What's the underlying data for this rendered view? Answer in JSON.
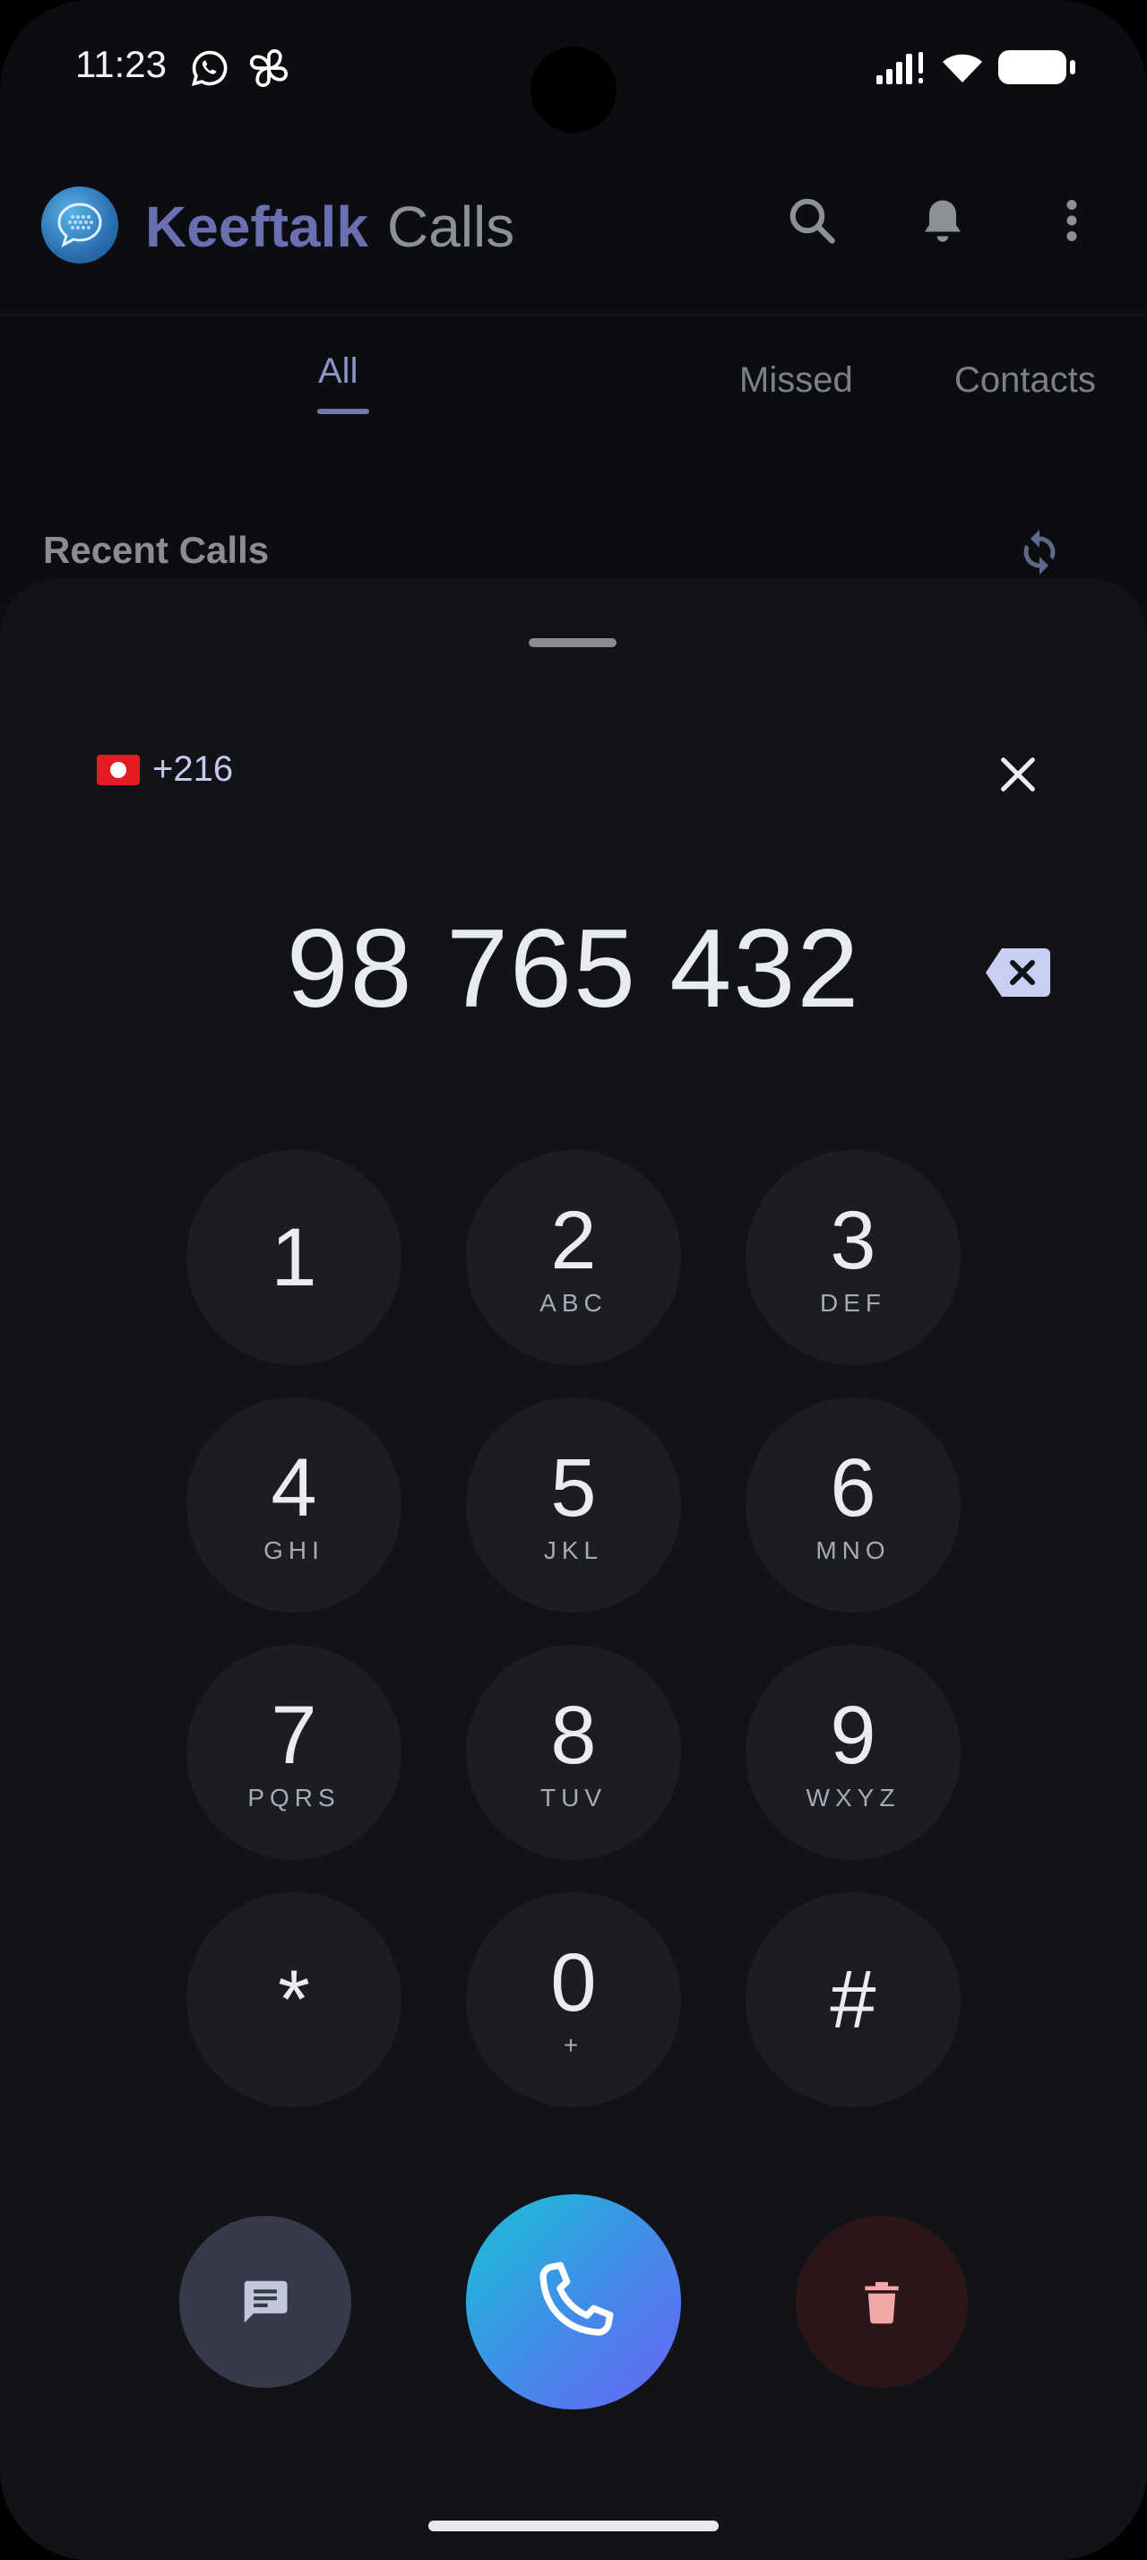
{
  "status_bar": {
    "time": "11:23"
  },
  "app_bar": {
    "brand": "Keeftalk",
    "title": "Calls"
  },
  "tabs": [
    {
      "label": "All",
      "active": true
    },
    {
      "label": "Missed"
    },
    {
      "label": "Contacts"
    }
  ],
  "recent": {
    "label": "Recent Calls"
  },
  "dialer": {
    "country_code": "+216",
    "number": "98 765 432",
    "keys": [
      {
        "digit": "1",
        "letters": ""
      },
      {
        "digit": "2",
        "letters": "ABC"
      },
      {
        "digit": "3",
        "letters": "DEF"
      },
      {
        "digit": "4",
        "letters": "GHI"
      },
      {
        "digit": "5",
        "letters": "JKL"
      },
      {
        "digit": "6",
        "letters": "MNO"
      },
      {
        "digit": "7",
        "letters": "PQRS"
      },
      {
        "digit": "8",
        "letters": "TUV"
      },
      {
        "digit": "9",
        "letters": "WXYZ"
      },
      {
        "digit": "*",
        "letters": ""
      },
      {
        "digit": "0",
        "letters": "+"
      },
      {
        "digit": "#",
        "letters": ""
      }
    ]
  },
  "colors": {
    "accent": "#6a6fb0",
    "call_gradient_start": "#19c3d6",
    "call_gradient_end": "#6b63f2",
    "delete_bg": "#2a1517",
    "delete_icon": "#f1a7a7",
    "message_bg": "#363a48"
  },
  "icons": {
    "status": [
      "whatsapp-icon",
      "pinwheel-icon",
      "signal-icon",
      "wifi-icon",
      "battery-icon"
    ],
    "app_bar": [
      "search-icon",
      "bell-icon",
      "more-vert-icon"
    ],
    "dialer": [
      "close-icon",
      "backspace-icon",
      "message-icon",
      "phone-icon",
      "trash-icon"
    ]
  }
}
